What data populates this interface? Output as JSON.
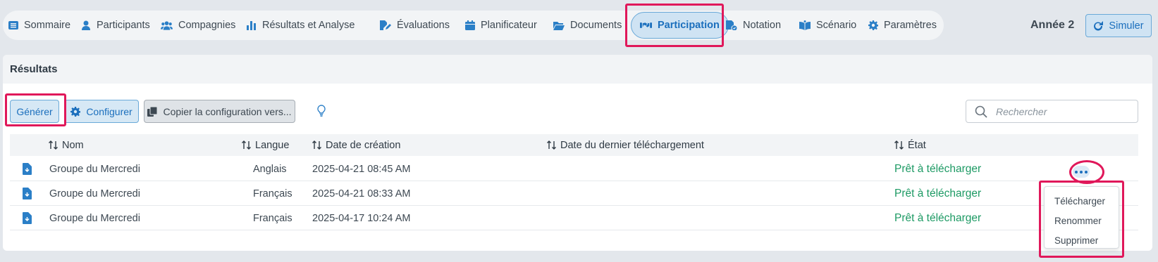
{
  "nav": {
    "items": [
      {
        "label": "Sommaire",
        "icon": "list-icon"
      },
      {
        "label": "Participants",
        "icon": "user-icon"
      },
      {
        "label": "Compagnies",
        "icon": "users-icon"
      },
      {
        "label": "Résultats et Analyse",
        "icon": "bar-chart-icon"
      },
      {
        "label": "Évaluations",
        "icon": "edit-file-icon"
      },
      {
        "label": "Planificateur",
        "icon": "calendar-icon"
      },
      {
        "label": "Documents",
        "icon": "folder-icon"
      },
      {
        "label": "Participation",
        "icon": "handshake-icon",
        "active": true
      },
      {
        "label": "Notation",
        "icon": "grade-file-icon"
      },
      {
        "label": "Scénario",
        "icon": "book-icon"
      },
      {
        "label": "Paramètres",
        "icon": "gear-icon"
      }
    ],
    "year_label": "Année 2",
    "simulate_label": "Simuler"
  },
  "panel": {
    "title": "Résultats",
    "toolbar": {
      "generate_label": "Générer",
      "configure_label": "Configurer",
      "copy_config_label": "Copier la configuration vers...",
      "search_placeholder": "Rechercher"
    },
    "table": {
      "columns": [
        "Nom",
        "Langue",
        "Date de création",
        "Date du dernier téléchargement",
        "État"
      ],
      "rows": [
        {
          "name": "Groupe du Mercredi",
          "language": "Anglais",
          "created": "2025-04-21 08:45 AM",
          "last_download": "",
          "state": "Prêt à télécharger"
        },
        {
          "name": "Groupe du Mercredi",
          "language": "Français",
          "created": "2025-04-21 08:33 AM",
          "last_download": "",
          "state": "Prêt à télécharger"
        },
        {
          "name": "Groupe du Mercredi",
          "language": "Français",
          "created": "2025-04-17 10:24 AM",
          "last_download": "",
          "state": "Prêt à télécharger"
        }
      ]
    },
    "row_menu": {
      "items": [
        "Télécharger",
        "Renommer",
        "Supprimer"
      ]
    }
  },
  "colors": {
    "accent": "#1b6fbd",
    "success": "#1d9a64",
    "highlight": "#e0185a"
  }
}
